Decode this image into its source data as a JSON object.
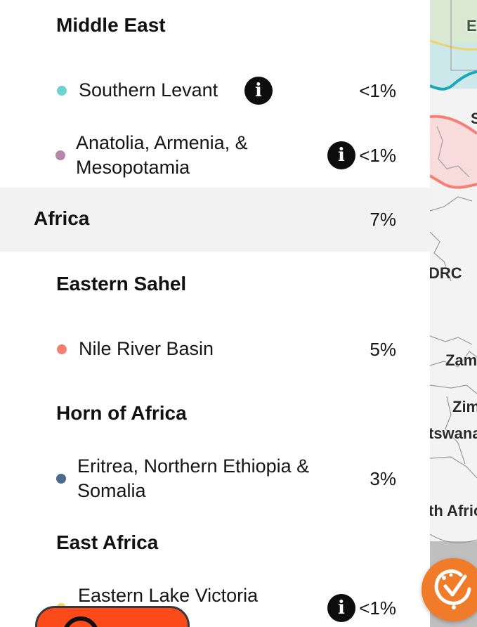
{
  "regions": {
    "middle_east_heading": "Middle East",
    "southern_levant": {
      "name": "Southern Levant",
      "percent": "<1%",
      "color": "#6dd3d0"
    },
    "anatolia": {
      "name": "Anatolia, Armenia, & Mesopotamia",
      "percent": "<1%",
      "color": "#b487a8"
    },
    "africa_group": {
      "label": "Africa",
      "percent": "7%"
    },
    "eastern_sahel_heading": "Eastern Sahel",
    "nile_river_basin": {
      "name": "Nile River Basin",
      "percent": "5%",
      "color": "#f47f72"
    },
    "horn_of_africa_heading": "Horn of Africa",
    "eritrea": {
      "name": "Eritrea, Northern Ethiopia & Somalia",
      "percent": "3%",
      "color": "#4d6a8a"
    },
    "east_africa_heading": "East Africa",
    "eastern_lake_victoria": {
      "name": "Eastern Lake Victoria",
      "percent": "<1%",
      "color": "#f2d06b"
    }
  },
  "info_icon_glyph": "i",
  "map_labels": {
    "egypt_partial": "E",
    "sudan_partial": "S",
    "drc": "DRC",
    "zambia_partial": "Zam",
    "zimbabwe_partial": "Zim",
    "botswana_partial": "tswana",
    "south_africa_partial": "th Afric"
  },
  "icons": {
    "info": "info-icon",
    "fab": "ancestry-discovery-icon",
    "bottom_button": "search-icon"
  }
}
